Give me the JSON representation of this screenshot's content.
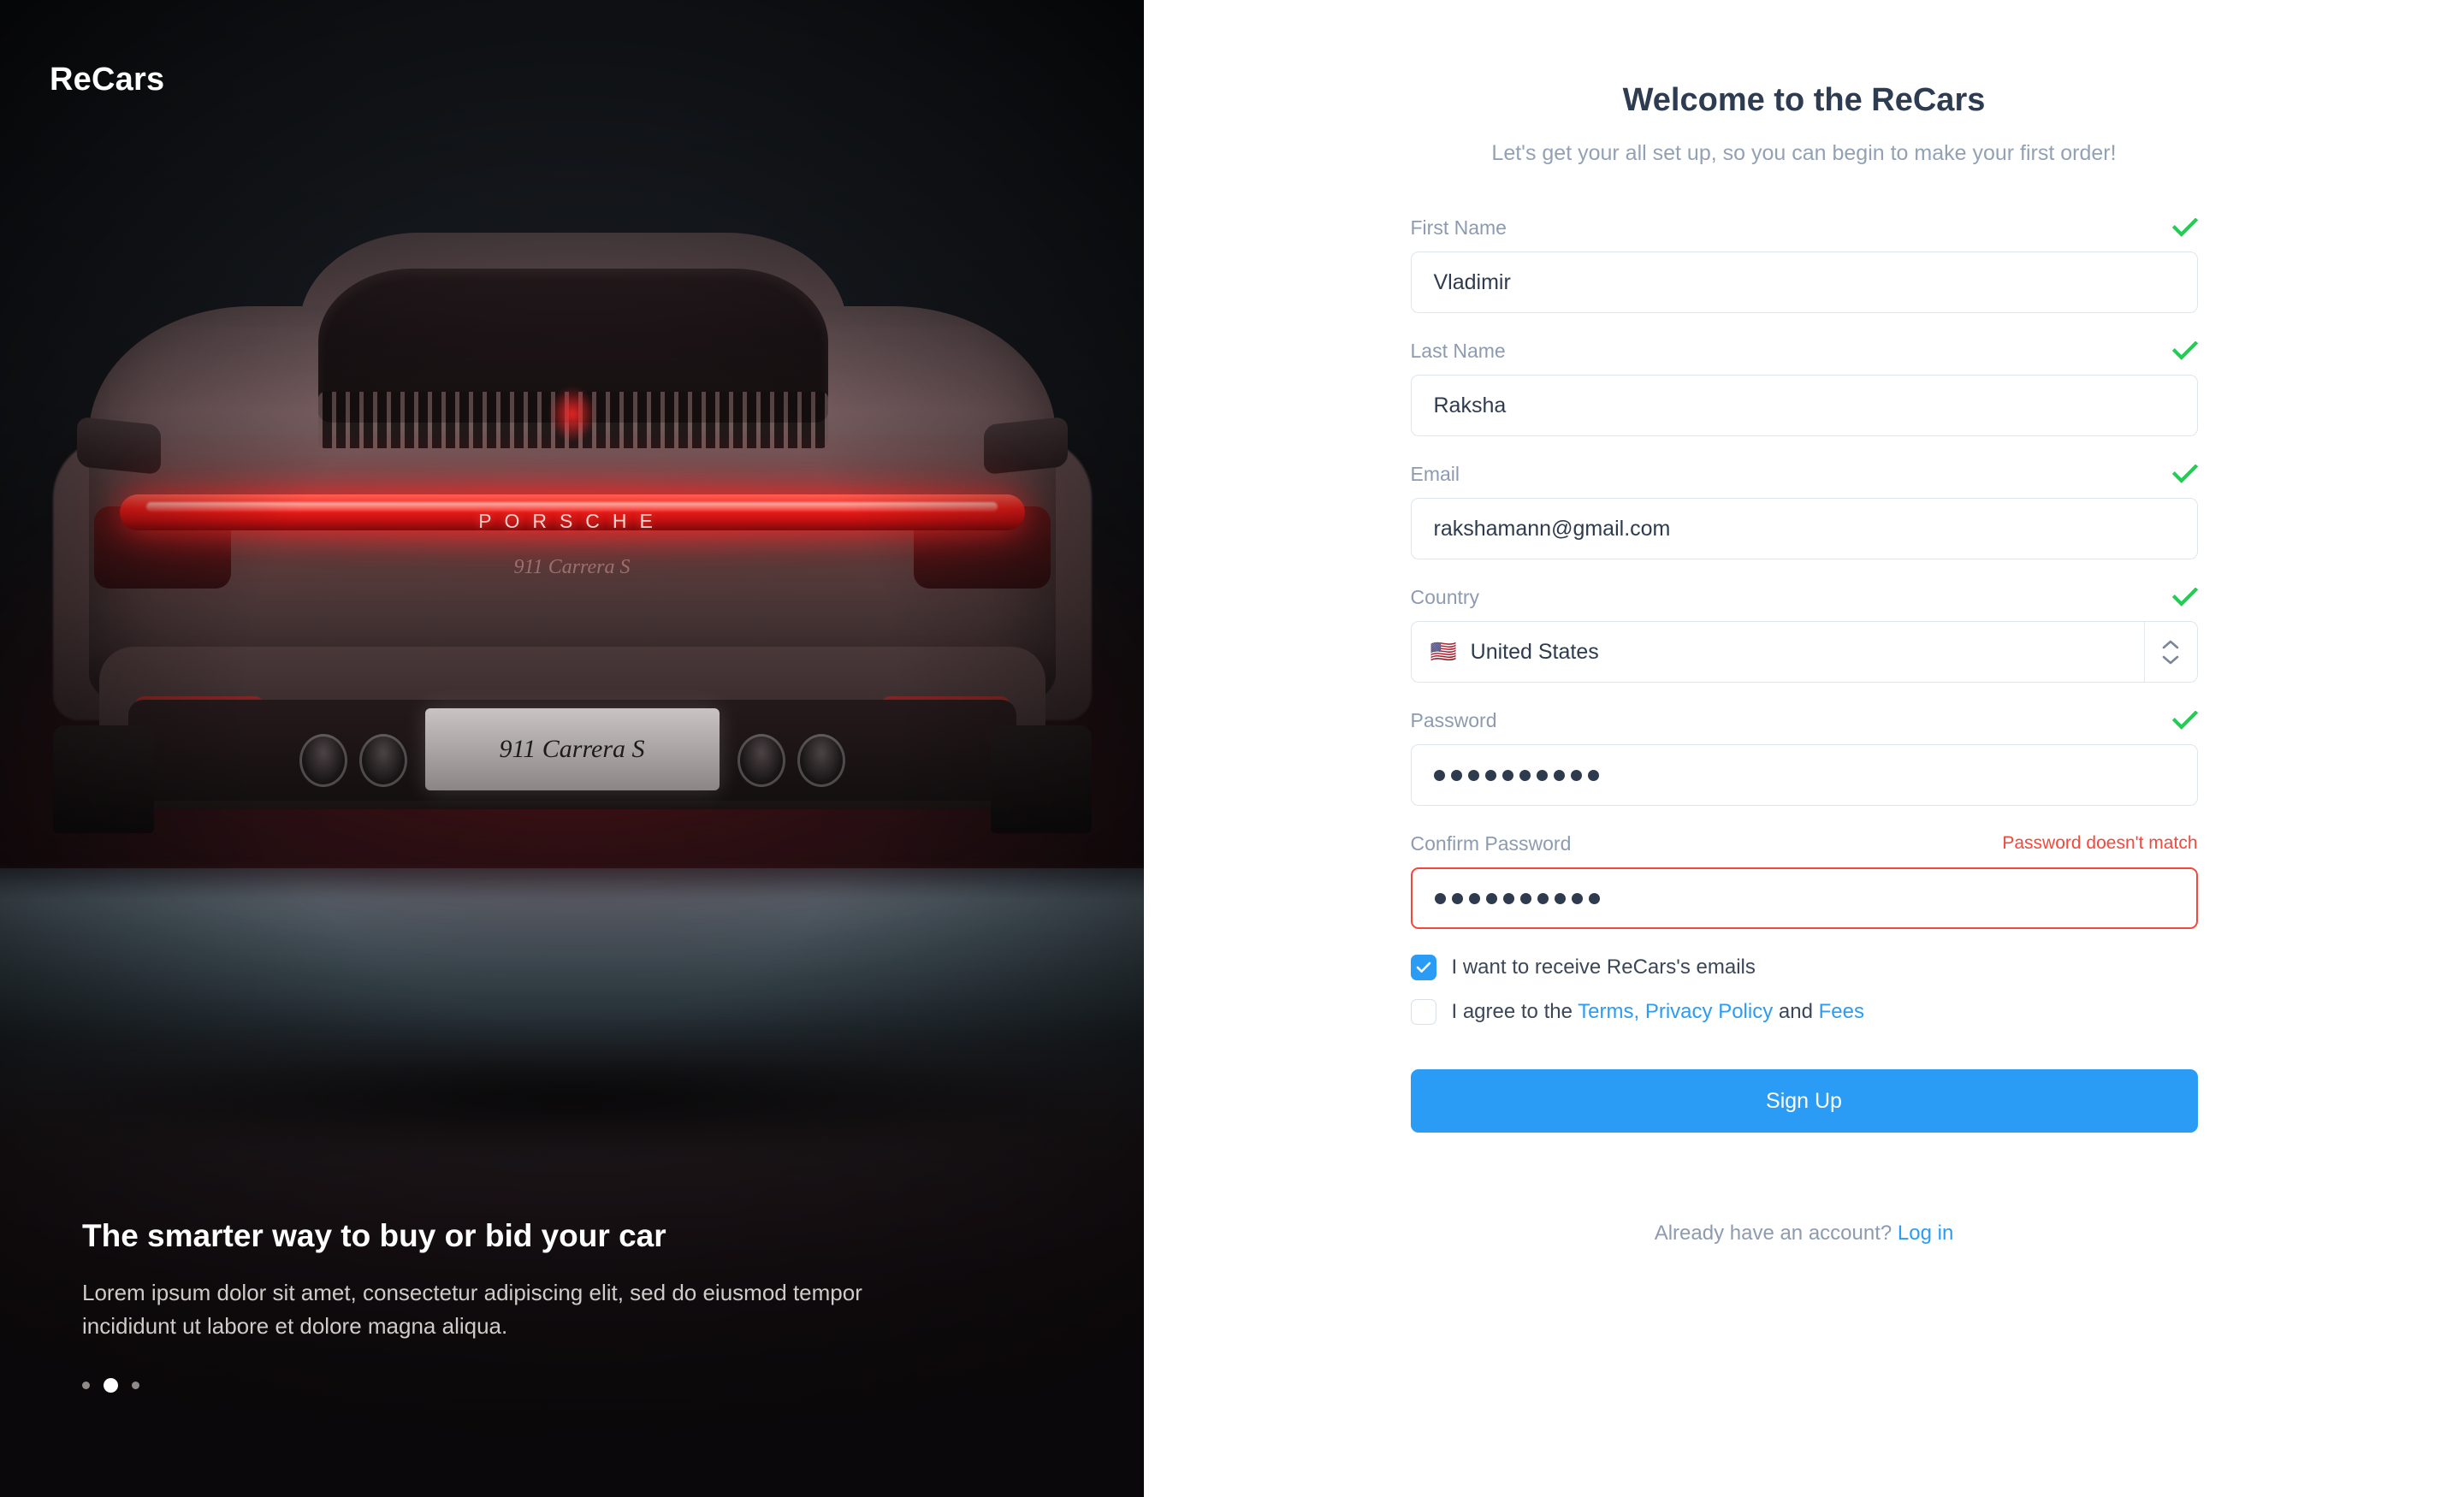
{
  "hero": {
    "brand": "ReCars",
    "headline": "The smarter way to buy or bid your car",
    "subtext": "Lorem ipsum dolor sit amet, consectetur adipiscing elit, sed do eiusmod tempor incididunt ut labore et dolore magna aliqua.",
    "car_badge_word": "PORSCHE",
    "car_model_badge": "911 Carrera S",
    "car_plate_text": "911 Carrera S",
    "carousel": {
      "total": 3,
      "active_index": 1
    }
  },
  "form": {
    "title": "Welcome to the ReCars",
    "subtitle": "Let's get your all set up, so you can begin to make your first order!",
    "fields": [
      {
        "label": "First Name",
        "value": "Vladimir",
        "status": "valid"
      },
      {
        "label": "Last Name",
        "value": "Raksha",
        "status": "valid"
      },
      {
        "label": "Email",
        "value": "rakshamann@gmail.com",
        "status": "valid"
      }
    ],
    "country": {
      "label": "Country",
      "value": "United States",
      "flag": "🇺🇸",
      "status": "valid",
      "stepper_icon": "chevron-up-down-icon"
    },
    "password": {
      "label": "Password",
      "masked_length": 10,
      "status": "valid"
    },
    "confirm_password": {
      "label": "Confirm Password",
      "masked_length": 10,
      "status": "error",
      "error_message": "Password doesn't match"
    },
    "checkboxes": [
      {
        "label": "I want to receive ReCars's emails",
        "checked": true
      },
      {
        "label_before": "I agree to the ",
        "link1": "Terms, Privacy Policy",
        "label_mid": " and ",
        "link2": "Fees",
        "checked": false
      }
    ],
    "submit_label": "Sign Up",
    "footer_prefix": "Already have an account? ",
    "footer_link": "Log in"
  },
  "colors": {
    "accent_blue": "#2a9cf5",
    "valid_green": "#22cc55",
    "error_red": "#f4483c",
    "label_gray": "#8d9bb0",
    "text_dark": "#2e3b4e",
    "hero_bg": "#16191f"
  }
}
